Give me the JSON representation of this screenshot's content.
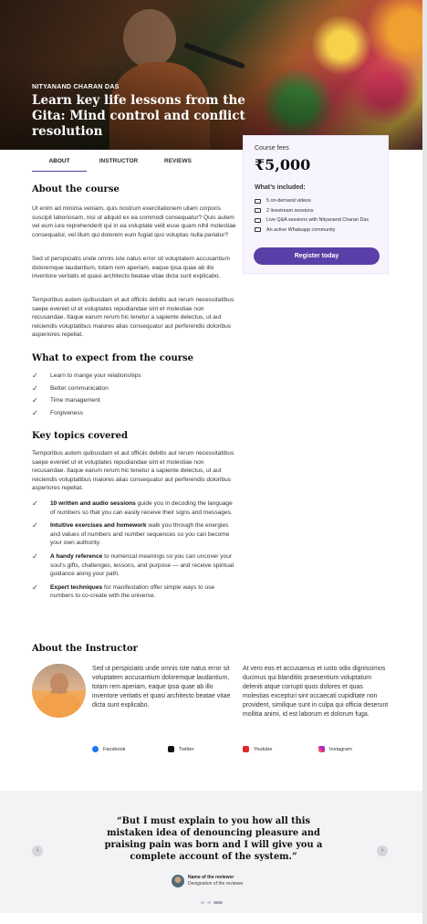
{
  "hero": {
    "instructor_name": "NITYANAND CHARAN DAS",
    "title": "Learn key life lessons from the Gita: Mind control and conflict resolution"
  },
  "tabs": [
    "ABOUT",
    "INSTRUCTOR",
    "REVIEWS"
  ],
  "about": {
    "heading": "About the course",
    "paragraphs": [
      "Ut enim ad minima veniam, quis nostrum exercitationem ullam corporis suscipit laboriosam, nisi ut aliquid ex ea commodi consequatur? Quis autem vel eum iure reprehenderit qui in ea voluptate velit esse quam nihil molestiae consequatur, vel illum qui dolorem eum fugiat quo voluptas nulla pariatur?",
      "Sed ut perspiciatis unde omnis iste natus error sit voluptatem accusantium doloremque laudantium, totam rem aperiam, eaque ipsa quae ab illo inventore veritatis et quasi architecto beatae vitae dicta sunt explicabo.",
      "Temporibus autem quibusdam et aut officiis debitis aut rerum necessitatibus saepe eveniet ut et voluptates repudiandae sint et molestiae non recusandae. Itaque earum rerum hic tenetur a sapiente delectus, ut aut reiciendis voluptatibus maiores alias consequatur aut perferendis doloribus asperiores repellat."
    ]
  },
  "expect": {
    "heading": "What to expect from the course",
    "items": [
      "Learn to mange your relationships",
      "Better communication",
      "Time management",
      "Forgiveness"
    ]
  },
  "topics": {
    "heading": "Key topics covered",
    "intro": "Temporibus autem quibusdam et aut officiis debitis aut rerum necessitatibus saepe eveniet ut et voluptates repudiandae sint et molestiae non recusandae. Itaque earum rerum hic tenetur a sapiente delectus, ut aut reiciendis voluptatibus maiores alias consequatur aut perferendis doloribus asperiores repellat.",
    "items": [
      {
        "bold": "10 written and audio sessions",
        "rest": " guide you in decoding the language of numbers so that you can easily receive their signs and messages."
      },
      {
        "bold": "Intuitive exercises and homework",
        "rest": " walk you through the energies and values of numbers and number sequences so you can become your own authority."
      },
      {
        "bold": "A handy reference",
        "rest": " to numerical meanings so you can uncover your soul’s gifts, challenges, lessons, and purpose — and receive spiritual guidance along your path."
      },
      {
        "bold": "Expert techniques",
        "rest": " for manifestation offer simple ways to use numbers to co-create with the universe."
      }
    ]
  },
  "card": {
    "fees_label": "Course fees",
    "price": "₹5,000",
    "included_label": "What’s included:",
    "features": [
      "5 on-demand videos",
      "2 livestream sessions",
      "Live Q&A sessions with Nityanand Charan Das",
      "An active Whatsapp community"
    ],
    "cta": "Register today"
  },
  "instructor": {
    "heading": "About the Instructor",
    "col1": "Sed ut perspiciatis unde omnis iste natus error sit voluptatem accusantium doloremque laudantium, totam rem aperiam, eaque ipsa quae ab illo inventore veritatis et quasi architecto beatae vitae dicta sunt explicabo.",
    "col2": "At vero eos et accusamus et iusto odio dignissimos ducimus qui blanditiis praesentium voluptatum deleniti atque corrupti quos dolores et quas molestias excepturi sint occaecati cupiditate non provident, similique sunt in culpa qui officia deserunt mollitia animi, id est laborum et dolorum fuga.",
    "social": [
      "Facebook",
      "Twitter",
      "Youtube",
      "Instagram"
    ]
  },
  "testimonial": {
    "quote": "“But I must explain to you how all this mistaken idea of denouncing pleasure and praising pain was born and I will give you a complete account of the system.”",
    "reviewer_name": "Name of the reviewer",
    "reviewer_designation": "Designation of the reviewer",
    "prev": "‹",
    "next": "›"
  },
  "colors": {
    "accent": "#5b3fa8",
    "card_bg": "#f7f4fd",
    "testimonial_bg": "#f3f3f5"
  },
  "icons": {
    "check": "✓"
  }
}
